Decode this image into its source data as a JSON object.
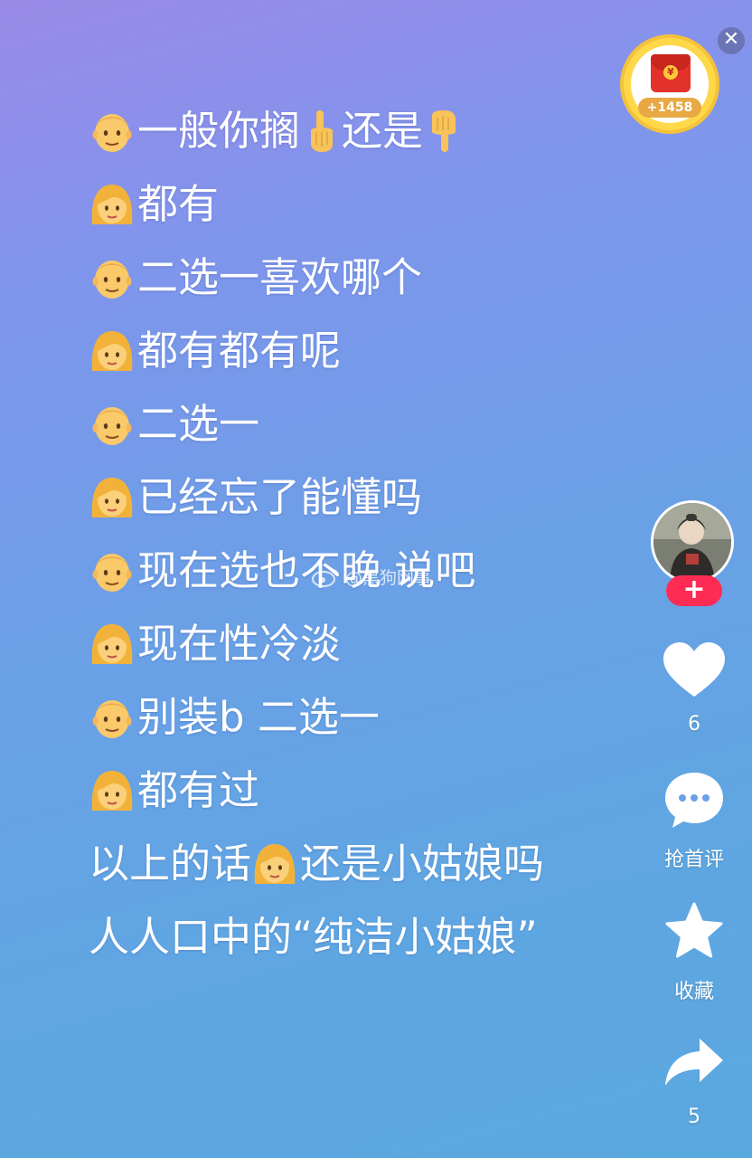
{
  "lines": [
    {
      "speaker": "man",
      "parts": [
        "一般你搁",
        "还是"
      ],
      "hands": [
        "pointing-up-icon",
        "pointing-down-icon"
      ]
    },
    {
      "speaker": "woman",
      "text": "都有"
    },
    {
      "speaker": "man",
      "text": "二选一喜欢哪个"
    },
    {
      "speaker": "woman",
      "text": "都有都有呢"
    },
    {
      "speaker": "man",
      "text": "二选一"
    },
    {
      "speaker": "woman",
      "text": "已经忘了能懂吗"
    },
    {
      "speaker": "man",
      "text": "现在选也不晚 说吧"
    },
    {
      "speaker": "woman",
      "text": "现在性冷淡"
    },
    {
      "speaker": "man",
      "text": "别装b 二选一"
    },
    {
      "speaker": "woman",
      "text": "都有过"
    },
    {
      "speaker": "none",
      "before": "以上的话",
      "after": "还是小姑娘吗"
    },
    {
      "speaker": "none",
      "text": "人人口中的“纯洁小姑娘”"
    }
  ],
  "reward": {
    "badge": "+1458",
    "seal": "¥"
  },
  "close_icon": "close-icon",
  "watermark": "@黑狗网事",
  "side": {
    "like_count": "6",
    "comment_label": "抢首评",
    "favorite_label": "收藏",
    "share_count": "5"
  },
  "colors": {
    "follow": "#fe2c55",
    "text": "#ffffff",
    "coin": "#ffd84a"
  }
}
